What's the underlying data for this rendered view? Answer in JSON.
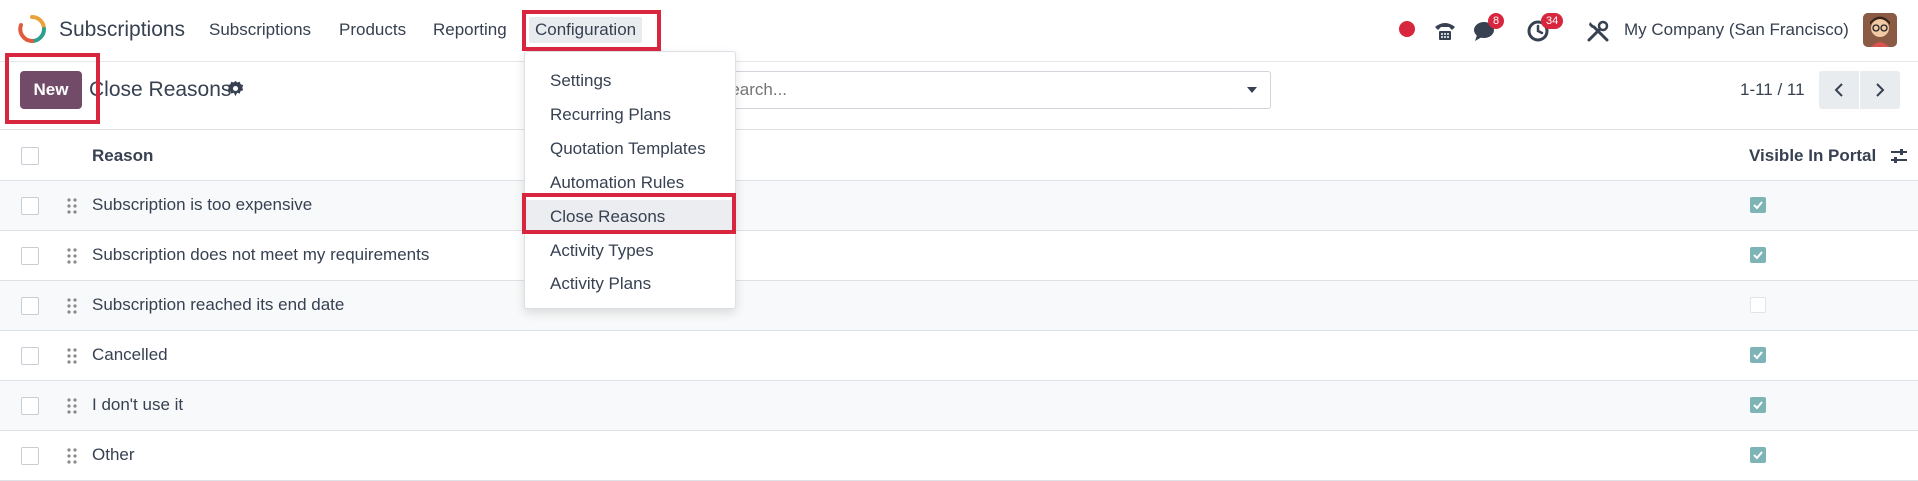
{
  "navbar": {
    "app_name": "Subscriptions",
    "menu": [
      "Subscriptions",
      "Products",
      "Reporting",
      "Configuration"
    ],
    "active_menu": "Configuration",
    "messages_badge": "8",
    "activities_badge": "34",
    "company": "My Company (San Francisco)"
  },
  "control_panel": {
    "new_label": "New",
    "title": "Close Reasons",
    "search_placeholder": "Search...",
    "pager": "1-11 / 11"
  },
  "list": {
    "columns": {
      "reason": "Reason",
      "visible_in_portal": "Visible In Portal"
    },
    "rows": [
      {
        "reason": "Subscription is too expensive",
        "visible_in_portal": true
      },
      {
        "reason": "Subscription does not meet my requirements",
        "visible_in_portal": true
      },
      {
        "reason": "Subscription reached its end date",
        "visible_in_portal": false
      },
      {
        "reason": "Cancelled",
        "visible_in_portal": true
      },
      {
        "reason": "I don't use it",
        "visible_in_portal": true
      },
      {
        "reason": "Other",
        "visible_in_portal": true
      }
    ]
  },
  "config_menu": {
    "items": [
      "Settings",
      "Recurring Plans",
      "Quotation Templates",
      "Automation Rules",
      "Close Reasons",
      "Activity Types",
      "Activity Plans"
    ],
    "selected": "Close Reasons"
  },
  "colors": {
    "brand": "#714b67",
    "checkbox_checked": "#7fb4b6",
    "badge": "#d7263d",
    "highlight_box": "#d7263d"
  },
  "icons": [
    "subscriptions-logo-icon",
    "gear-icon",
    "caret-down-icon",
    "chevron-left-icon",
    "chevron-right-icon",
    "drag-handle-icon",
    "phone-icon",
    "chat-icon",
    "clock-icon",
    "tools-icon",
    "column-settings-icon"
  ]
}
